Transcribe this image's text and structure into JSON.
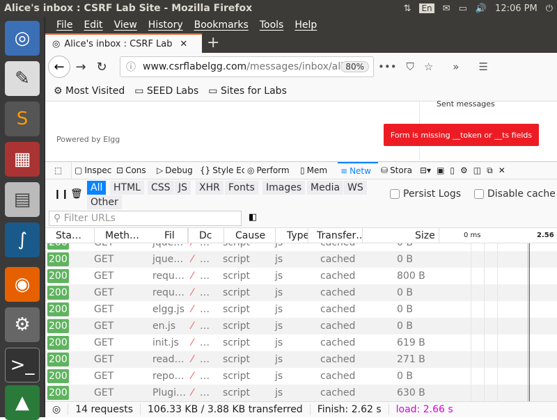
{
  "window_title": "Alice's inbox : CSRF Lab Site - Mozilla Firefox",
  "tray": {
    "lang": "En",
    "time": "12:06 PM"
  },
  "menu": [
    "File",
    "Edit",
    "View",
    "History",
    "Bookmarks",
    "Tools",
    "Help"
  ],
  "tab": {
    "title": "Alice's inbox : CSRF Lab S",
    "new_tab": "+"
  },
  "url": {
    "domain": "www.csrflabelgg.com",
    "path": "/messages/inbox/alice",
    "zoom": "80%"
  },
  "bookmarks": [
    "Most Visited",
    "SEED Labs",
    "Sites for Labs"
  ],
  "page": {
    "sent_messages": "Sent messages",
    "powered": "Powered by Elgg",
    "error": "Form is missing __token or __ts fields"
  },
  "devtools": {
    "tools": [
      "Inspec",
      "Cons",
      "Debug",
      "Style Ec",
      "Perform",
      "Mem",
      "Netw",
      "Stora"
    ],
    "filters": [
      "All",
      "HTML",
      "CSS",
      "JS",
      "XHR",
      "Fonts",
      "Images",
      "Media",
      "WS",
      "Other"
    ],
    "persist_logs": "Persist Logs",
    "disable_cache": "Disable cache",
    "filter_placeholder": "Filter URLs",
    "columns": [
      "Sta…",
      "Meth…",
      "Fil",
      "Dc",
      "Cause",
      "Type",
      "Transfer…",
      "Size",
      "0 ms",
      "2.56"
    ],
    "rows": [
      {
        "status": "200",
        "method": "GET",
        "file": "jque…",
        "domain": "…",
        "cause": "script",
        "type": "js",
        "transferred": "cached",
        "size": "0 B"
      },
      {
        "status": "200",
        "method": "GET",
        "file": "jque…",
        "domain": "…",
        "cause": "script",
        "type": "js",
        "transferred": "cached",
        "size": "0 B"
      },
      {
        "status": "200",
        "method": "GET",
        "file": "requ…",
        "domain": "…",
        "cause": "script",
        "type": "js",
        "transferred": "cached",
        "size": "800 B"
      },
      {
        "status": "200",
        "method": "GET",
        "file": "requ…",
        "domain": "…",
        "cause": "script",
        "type": "js",
        "transferred": "cached",
        "size": "0 B"
      },
      {
        "status": "200",
        "method": "GET",
        "file": "elgg.js",
        "domain": "…",
        "cause": "script",
        "type": "js",
        "transferred": "cached",
        "size": "0 B"
      },
      {
        "status": "200",
        "method": "GET",
        "file": "en.js",
        "domain": "…",
        "cause": "script",
        "type": "js",
        "transferred": "cached",
        "size": "0 B"
      },
      {
        "status": "200",
        "method": "GET",
        "file": "init.js",
        "domain": "…",
        "cause": "script",
        "type": "js",
        "transferred": "cached",
        "size": "619 B"
      },
      {
        "status": "200",
        "method": "GET",
        "file": "read…",
        "domain": "…",
        "cause": "script",
        "type": "js",
        "transferred": "cached",
        "size": "271 B"
      },
      {
        "status": "200",
        "method": "GET",
        "file": "repo…",
        "domain": "…",
        "cause": "script",
        "type": "js",
        "transferred": "cached",
        "size": "0 B"
      },
      {
        "status": "200",
        "method": "GET",
        "file": "Plugi…",
        "domain": "…",
        "cause": "script",
        "type": "js",
        "transferred": "cached",
        "size": "630 B"
      }
    ],
    "footer": {
      "requests": "14 requests",
      "transferred": "106.33 KB / 3.88 KB transferred",
      "finish": "Finish: 2.62 s",
      "load": "load: 2.66 s"
    }
  }
}
